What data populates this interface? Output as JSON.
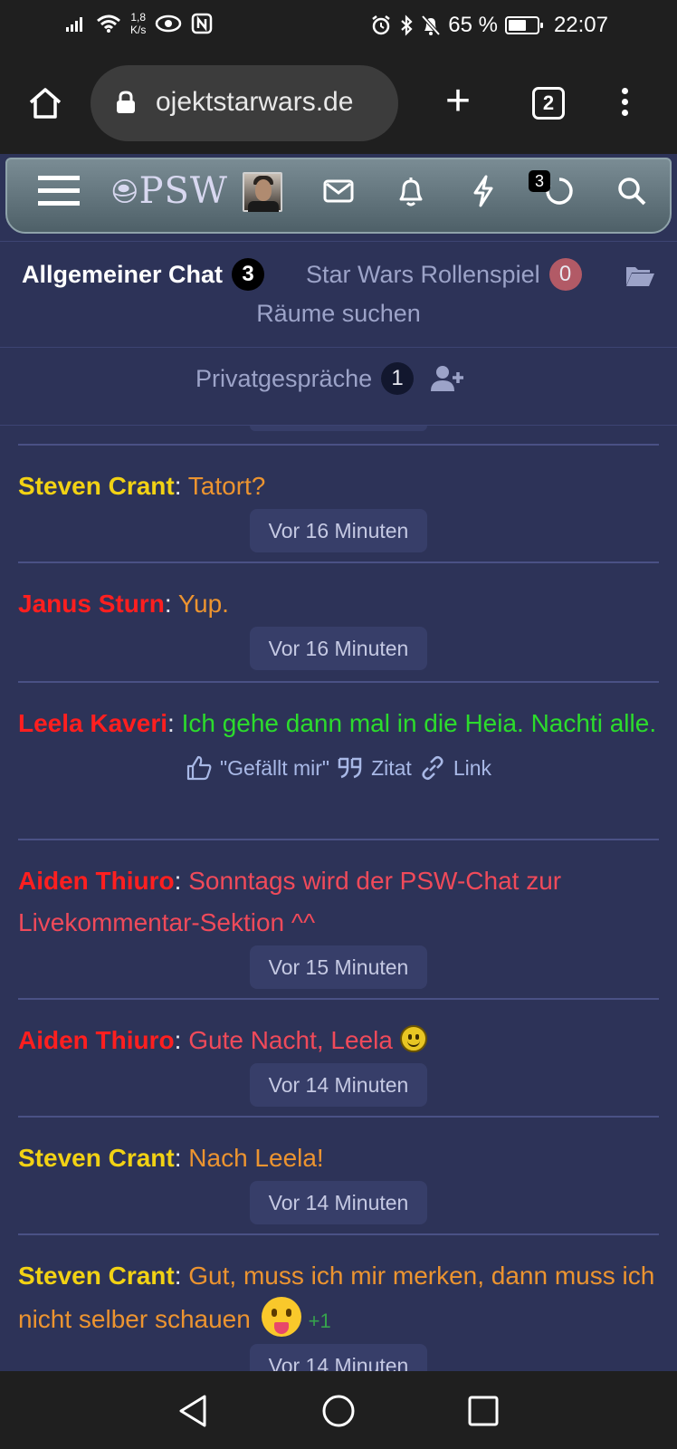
{
  "status": {
    "network_speed_value": "1,8",
    "network_speed_unit": "K/s",
    "battery": "65 %",
    "battery_level": 0.65,
    "time": "22:07"
  },
  "browser": {
    "url": "ojektstarwars.de",
    "tab_count": "2"
  },
  "header": {
    "logo_text": "PSW",
    "activity_badge": "3",
    "icons": [
      "menu-icon",
      "logo",
      "avatar",
      "mail-icon",
      "bell-icon",
      "bolt-icon",
      "circle-icon",
      "search-icon"
    ]
  },
  "rooms": {
    "active": {
      "label": "Allgemeiner Chat",
      "count": "3"
    },
    "other": {
      "label": "Star Wars Rollenspiel",
      "count": "0"
    },
    "search_label": "Räume suchen",
    "private_label": "Privatgespräche",
    "private_count": "1"
  },
  "messages": [
    {
      "author": "Steven Crant",
      "author_color": "#f2d214",
      "text": "Tatort?",
      "text_color": "#ec9430",
      "time": "Vor 16 Minuten"
    },
    {
      "author": "Janus Sturn",
      "author_color": "#ff1f1f",
      "text": "Yup.",
      "text_color": "#ec9430",
      "time": "Vor 16 Minuten"
    },
    {
      "author": "Leela Kaveri",
      "author_color": "#ff1f1f",
      "text": "Ich gehe dann mal in die Heia. Nachti alle.",
      "text_color": "#2cdc2c",
      "actions": {
        "like": "\"Gefällt mir\"",
        "quote": "Zitat",
        "link": "Link"
      }
    },
    {
      "author": "Aiden Thiuro",
      "author_color": "#ff1f1f",
      "text": "Sonntags wird der PSW-Chat zur Livekommentar-Sektion ^^",
      "text_color": "#f04a5a",
      "time": "Vor 15 Minuten"
    },
    {
      "author": "Aiden Thiuro",
      "author_color": "#ff1f1f",
      "text": "Gute Nacht, Leela",
      "text_color": "#f04a5a",
      "time": "Vor 14 Minuten"
    },
    {
      "author": "Steven Crant",
      "author_color": "#f2d214",
      "text": "Nach Leela!",
      "text_color": "#ec9430",
      "time": "Vor 14 Minuten"
    },
    {
      "author": "Steven Crant",
      "author_color": "#f2d214",
      "text": "Gut, muss ich mir merken, dann muss ich nicht selber schauen",
      "text_color": "#ec9430",
      "reaction": "+1",
      "time": "Vor 14 Minuten"
    }
  ],
  "colors": {
    "page_bg": "#2d3358",
    "divider": "#4a5185",
    "pill_bg": "#373e69"
  }
}
